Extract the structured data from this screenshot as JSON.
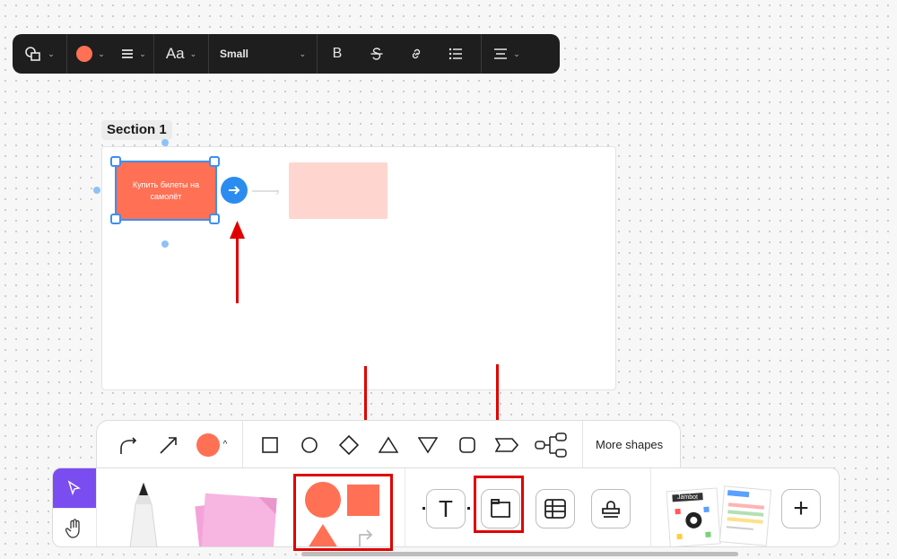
{
  "format_toolbar": {
    "font_size_icon": "Aa",
    "font_size_value": "Small",
    "bold_glyph": "B",
    "fill_color": "#ff7055"
  },
  "section": {
    "label": "Section 1",
    "sticky_text": "Купить билеты на самолёт",
    "sticky_color": "#ff7055",
    "ghost_color": "#ffd6cf"
  },
  "shapes_toolbar": {
    "more_shapes_label": "More shapes",
    "shape_color": "#ff7055"
  },
  "main_toolbar": {
    "accent_color": "#7a4df0",
    "add_glyph": "+",
    "text_glyph": "T",
    "templates_card_title": "Jambot"
  },
  "annotation_color": "#e00000"
}
